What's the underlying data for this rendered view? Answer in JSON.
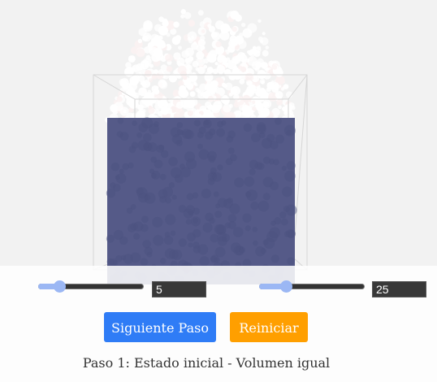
{
  "controls": {
    "slider1": {
      "value": 5
    },
    "slider2": {
      "value": 25
    },
    "input1_value": "5",
    "input2_value": "25",
    "next_step_label": "Siguiente Paso",
    "reset_label": "Reiniciar"
  },
  "status_text": "Paso 1: Estado inicial - Volumen igual",
  "colors": {
    "background": "#f2f2f2",
    "liquid": "#555a88",
    "particles": "#ffffff",
    "slider_accent": "#9bb7f4",
    "next_button": "#2f7cf6",
    "reset_button": "#ff9f00"
  }
}
